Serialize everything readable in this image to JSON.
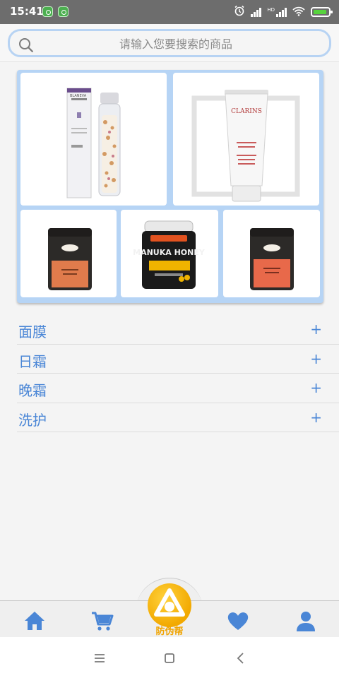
{
  "status_bar": {
    "time": "15:41",
    "network_label": "HD"
  },
  "search": {
    "placeholder": "请输入您要搜索的商品"
  },
  "products": [
    {
      "brand": "BLANEVA",
      "type": "serum"
    },
    {
      "brand": "CLARINS",
      "type": "cleanser"
    },
    {
      "brand": "",
      "type": "jar"
    },
    {
      "brand": "MANUKA HONEY",
      "type": "honey"
    },
    {
      "brand": "",
      "type": "jar"
    }
  ],
  "categories": [
    {
      "label": "面膜",
      "action": "+"
    },
    {
      "label": "日霜",
      "action": "+"
    },
    {
      "label": "晚霜",
      "action": "+"
    },
    {
      "label": "洗护",
      "action": "+"
    }
  ],
  "tab_bar": {
    "center_label": "防伪帮",
    "tabs": [
      "home-icon",
      "cart-icon",
      "heart-icon",
      "user-icon"
    ],
    "accent_color": "#4a86d6",
    "center_color": "#f2a900"
  },
  "nav_bar": {
    "buttons": [
      "menu-icon",
      "square-icon",
      "back-icon"
    ]
  }
}
